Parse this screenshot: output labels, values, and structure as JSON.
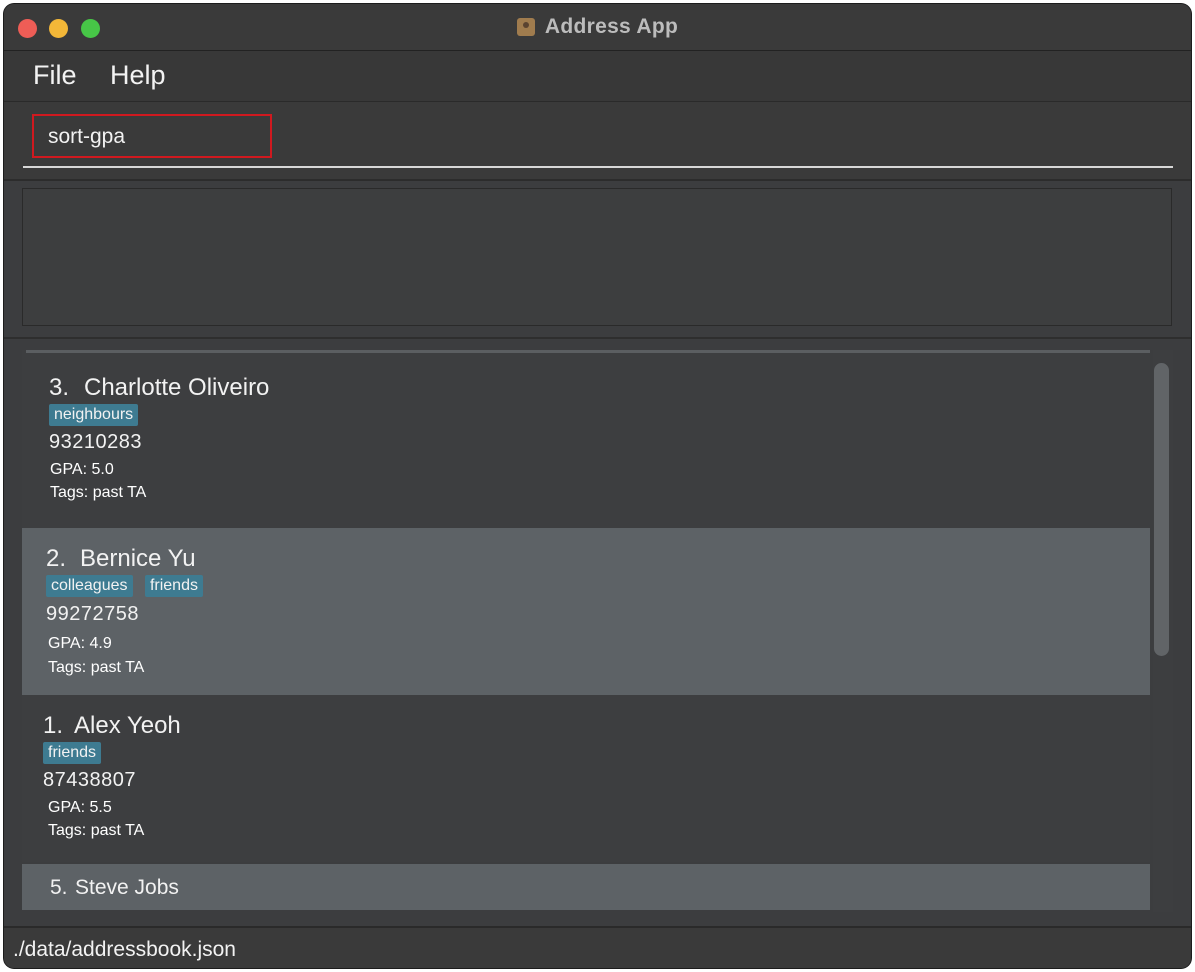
{
  "window": {
    "title": "Address App"
  },
  "menu": {
    "file": "File",
    "help": "Help"
  },
  "command": {
    "value": "sort-gpa"
  },
  "result": {
    "text": ""
  },
  "persons": [
    {
      "index": "3.",
      "name": "Charlotte Oliveiro",
      "tags": [
        "neighbours"
      ],
      "phone": "93210283",
      "gpa": "GPA: 5.0",
      "extra_tags": "Tags: past TA"
    },
    {
      "index": "2.",
      "name": "Bernice Yu",
      "tags": [
        "colleagues",
        "friends"
      ],
      "phone": "99272758",
      "gpa": "GPA: 4.9",
      "extra_tags": "Tags: past TA"
    },
    {
      "index": "1.",
      "name": "Alex Yeoh",
      "tags": [
        "friends"
      ],
      "phone": "87438807",
      "gpa": "GPA: 5.5",
      "extra_tags": "Tags: past TA"
    },
    {
      "index": "5.",
      "name": "Steve Jobs"
    }
  ],
  "status": {
    "path": "./data/addressbook.json"
  },
  "colors": {
    "tag_bg": "#3e7b91",
    "selected_card": "#5d6266",
    "window_bg": "#3c3d3f",
    "command_highlight": "#d0191f"
  }
}
